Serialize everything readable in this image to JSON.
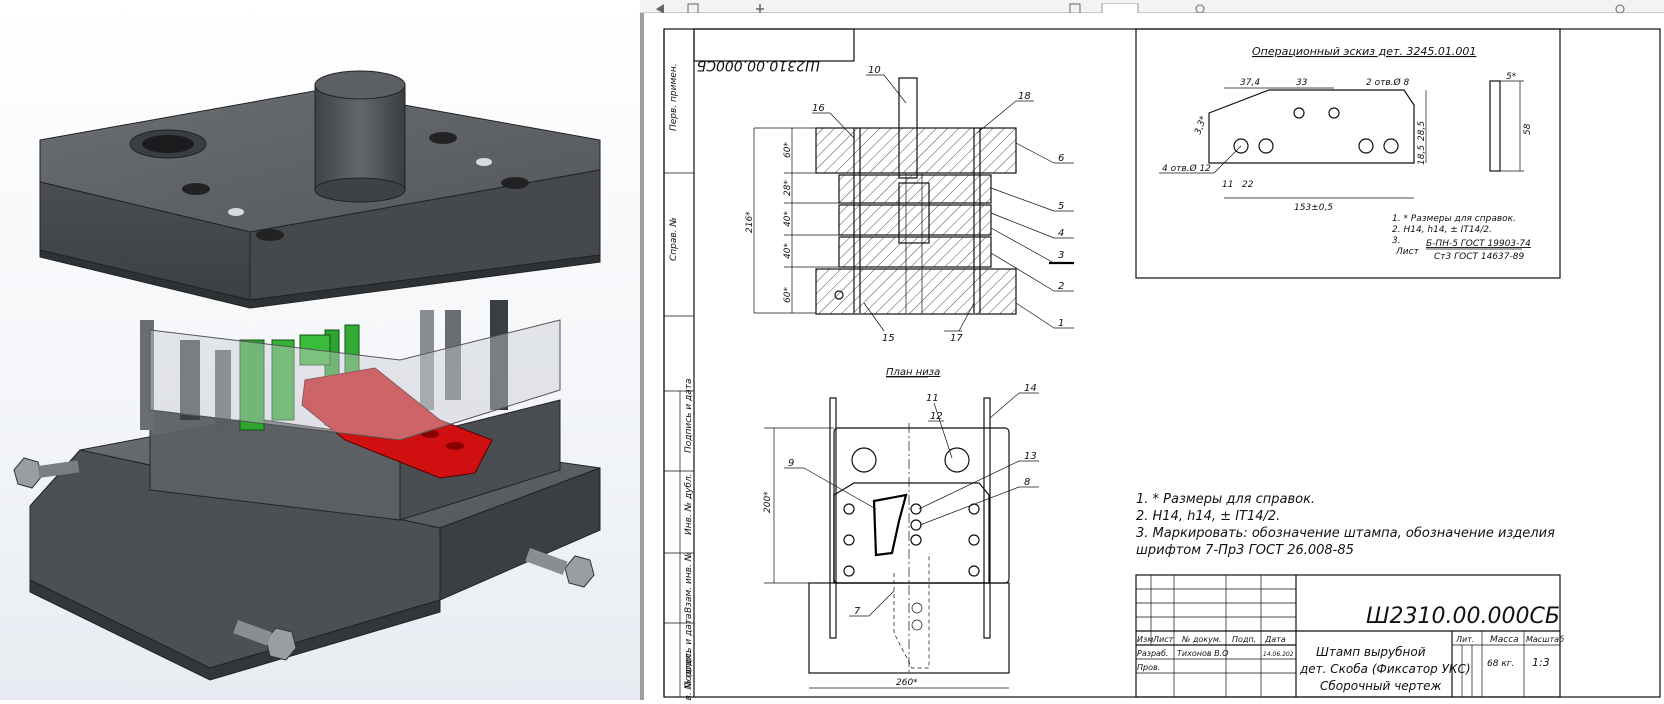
{
  "sidebar": {
    "cells": [
      "Перв. примен.",
      "Справ. №",
      "Подпись и дата",
      "Инв. № дубл.",
      "Взам. инв. №",
      "Подпись и дата",
      "Инв. № подл."
    ]
  },
  "drawing": {
    "mirrored_code": "Ш2310.00.000СБ",
    "section_dims": [
      "60*",
      "28*",
      "40*",
      "40*",
      "60*",
      "216*"
    ],
    "callouts": [
      "10",
      "16",
      "18",
      "6",
      "5",
      "4",
      "3",
      "2",
      "1",
      "15",
      "17"
    ],
    "plan_title": "План низа",
    "plan_callouts": [
      "11",
      "12",
      "14",
      "13",
      "9",
      "8",
      "7"
    ],
    "plan_dims": [
      "200*",
      "260*"
    ]
  },
  "sketch": {
    "title": "Операционный эскиз дет. 3245.01.001",
    "dims": [
      "37,4",
      "33",
      "2 отв.Ø 8",
      "5*",
      "3,3*",
      "28,5",
      "58",
      "18,5",
      "4 отв.Ø 12",
      "11",
      "22",
      "153±0,5"
    ],
    "notes": [
      "1. * Размеры для справок.",
      "2. Н14, h14, ± IT14/2.",
      "3.",
      "Лист",
      "Б-ПН-5 ГОСТ 19903-74",
      "Ст3 ГОСТ 14637-89"
    ]
  },
  "notes": {
    "line1": "1. * Размеры для справок.",
    "line2": "2. Н14, h14, ± IT14/2.",
    "line3": "3. Маркировать: обозначение штампа, обозначение изделия",
    "line4": "шрифтом 7-Пр3 ГОСТ 26.008-85"
  },
  "title_block": {
    "code": "Ш2310.00.000СБ",
    "headers": [
      "Изм",
      "Лист",
      "№ докум.",
      "Подп.",
      "Дата"
    ],
    "razrab": "Разраб.",
    "author": "Тихонов В.О",
    "date": "14.06.202",
    "prov": "Пров.",
    "name1": "Штамп вырубной",
    "name2": "дет. Скоба (Фиксатор УКС)",
    "name3": "Сборочный чертеж",
    "lit": "Лит.",
    "mass_label": "Масса",
    "scale_label": "Масштаб",
    "mass": "68 кг.",
    "scale": "1:3"
  },
  "colors": {
    "die_body": "#505458",
    "die_edge": "#2a2c2e",
    "glass": "#c9cdd2",
    "green_part": "#2ea52e",
    "red_strip": "#d01010"
  },
  "icons": [
    "left-arrow-icon",
    "page-icon",
    "zoom-icon",
    "page-view-icon",
    "select-icon",
    "search-icon",
    "settings-icon"
  ]
}
